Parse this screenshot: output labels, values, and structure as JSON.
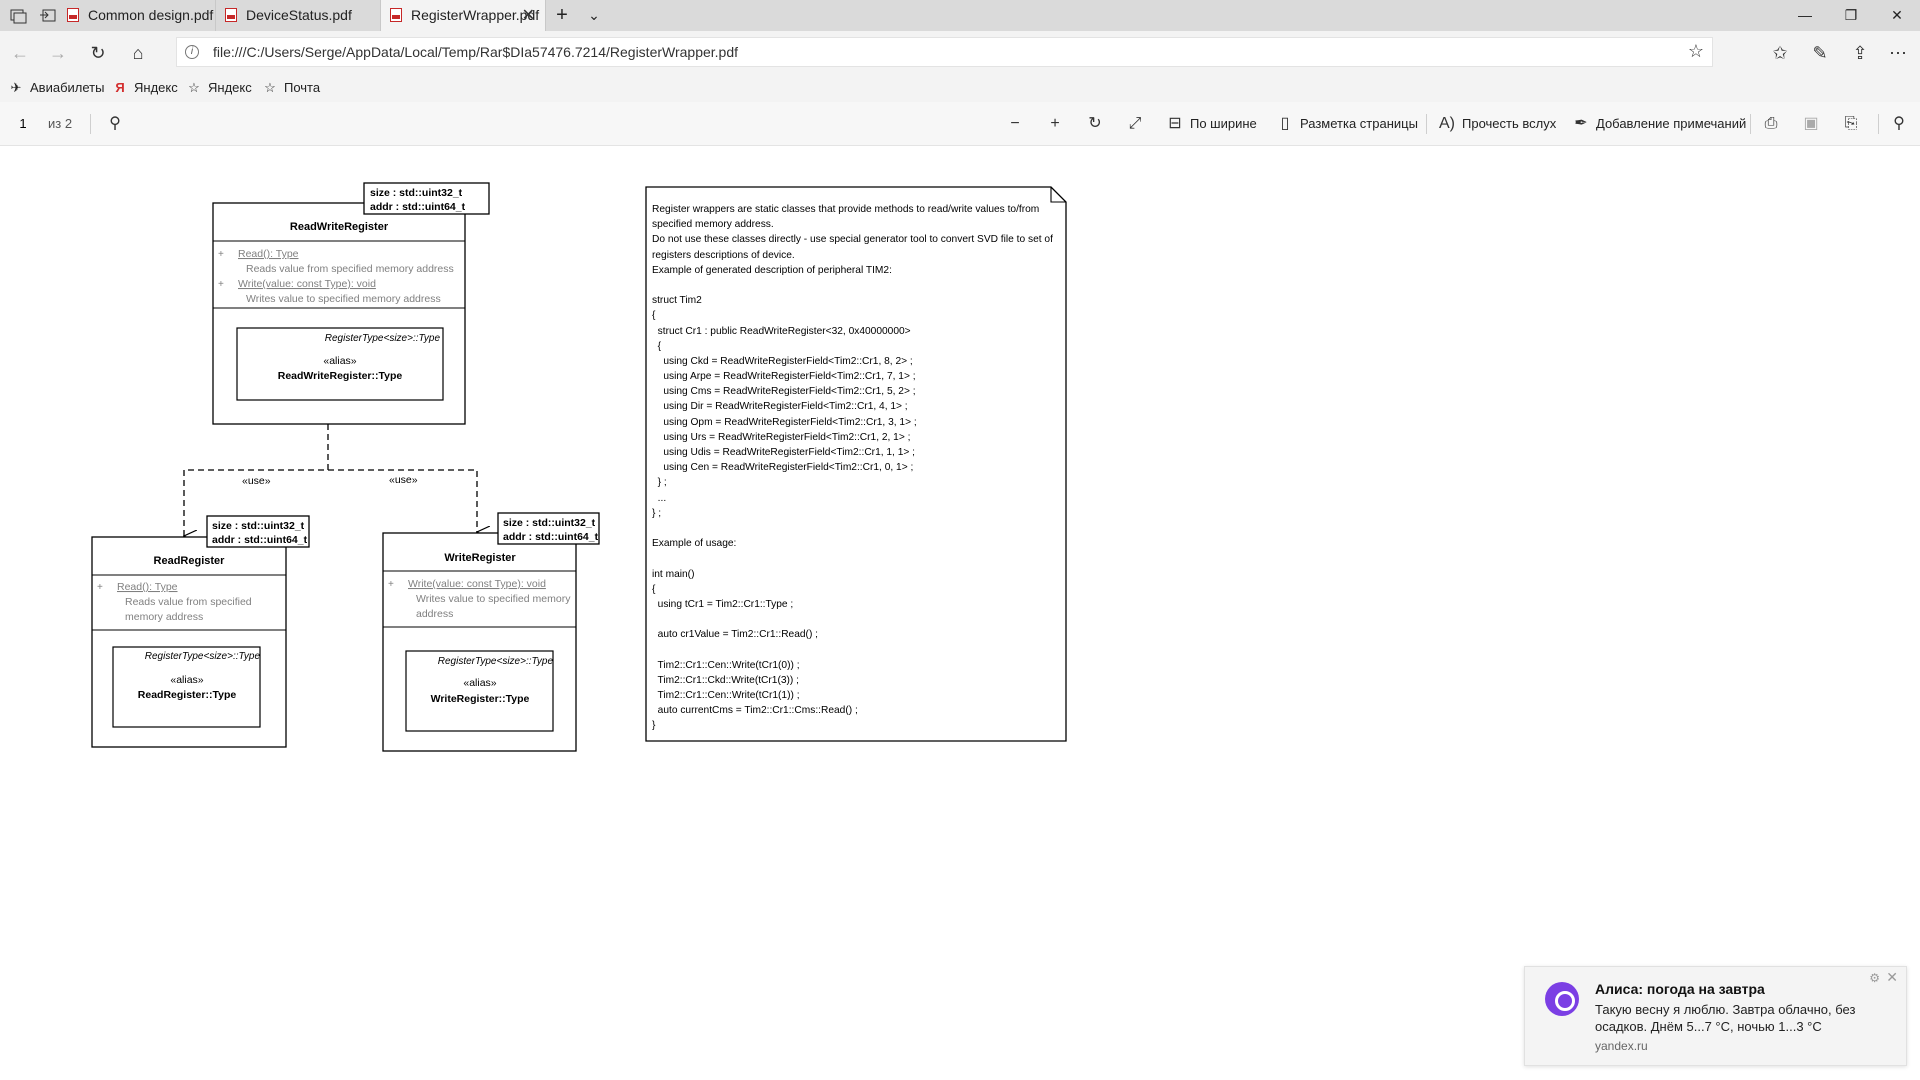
{
  "tabs": [
    {
      "label": "Common design.pdf",
      "active": false
    },
    {
      "label": "DeviceStatus.pdf",
      "active": false
    },
    {
      "label": "RegisterWrapper.pdf",
      "active": true
    }
  ],
  "window": {
    "minimize": "—",
    "restore": "❐",
    "close": "✕"
  },
  "address": {
    "url": "file:///C:/Users/Serge/AppData/Local/Temp/Rar$DIa57476.7214/RegisterWrapper.pdf"
  },
  "favorites": [
    {
      "label": "Авиабилеты",
      "icon": "plane-icon"
    },
    {
      "label": "Яндекс",
      "icon": "yandex-icon"
    },
    {
      "label": "Яндекс",
      "icon": "star-icon"
    },
    {
      "label": "Почта",
      "icon": "star-icon"
    }
  ],
  "pdf_toolbar": {
    "page": "1",
    "page_total": "из 2",
    "fit_width": "По ширине",
    "page_layout": "Разметка страницы",
    "read_aloud": "Прочесть вслух",
    "add_notes": "Добавление примечаний"
  },
  "diagram": {
    "rwr": {
      "template_size": "size : std::uint32_t",
      "template_addr": "addr : std::uint64_t",
      "name": "ReadWriteRegister",
      "op1": "Read(): Type",
      "op1_desc": "Reads value from specified memory address",
      "op2": "Write(value: const Type): void",
      "op2_desc": "Writes value to specified memory address",
      "inner_type": "RegisterType<size>::Type",
      "inner_stereo": "«alias»",
      "inner_name": "ReadWriteRegister::Type"
    },
    "use_left": "«use»",
    "use_right": "«use»",
    "rr": {
      "template_size": "size : std::uint32_t",
      "template_addr": "addr : std::uint64_t",
      "name": "ReadRegister",
      "op1": "Read(): Type",
      "op1_desc_1": "Reads value from specified",
      "op1_desc_2": "memory address",
      "inner_type": "RegisterType<size>::Type",
      "inner_stereo": "«alias»",
      "inner_name": "ReadRegister::Type"
    },
    "wr": {
      "template_size": "size : std::uint32_t",
      "template_addr": "addr : std::uint64_t",
      "name": "WriteRegister",
      "op1": "Write(value: const Type): void",
      "op1_desc_1": "Writes value to specified memory",
      "op1_desc_2": "address",
      "inner_type": "RegisterType<size>::Type",
      "inner_stereo": "«alias»",
      "inner_name": "WriteRegister::Type"
    }
  },
  "note_lines": [
    "Register wrappers are static classes that provide methods to read/write values to/from",
    "specified memory address.",
    "Do not use these classes directly - use special generator tool to convert SVD file to set of",
    "registers descriptions of device.",
    "Example of generated description of peripheral TIM2:",
    "",
    "struct Tim2",
    "{",
    "  struct Cr1 : public ReadWriteRegister<32, 0x40000000>",
    "  {",
    "    using Ckd = ReadWriteRegisterField<Tim2::Cr1, 8, 2> ;",
    "    using Arpe = ReadWriteRegisterField<Tim2::Cr1, 7, 1> ;",
    "    using Cms = ReadWriteRegisterField<Tim2::Cr1, 5, 2> ;",
    "    using Dir = ReadWriteRegisterField<Tim2::Cr1, 4, 1> ;",
    "    using Opm = ReadWriteRegisterField<Tim2::Cr1, 3, 1> ;",
    "    using Urs = ReadWriteRegisterField<Tim2::Cr1, 2, 1> ;",
    "    using Udis = ReadWriteRegisterField<Tim2::Cr1, 1, 1> ;",
    "    using Cen = ReadWriteRegisterField<Tim2::Cr1, 0, 1> ;",
    "  } ;",
    "  ...",
    "} ;",
    "",
    "Example of usage:",
    "",
    "int main()",
    "{",
    "  using tCr1 = Tim2::Cr1::Type ;",
    "",
    "  auto cr1Value = Tim2::Cr1::Read() ;",
    "",
    "  Tim2::Cr1::Cen::Write(tCr1(0)) ;",
    "  Tim2::Cr1::Ckd::Write(tCr1(3)) ;",
    "  Tim2::Cr1::Cen::Write(tCr1(1)) ;",
    "  auto currentCms = Tim2::Cr1::Cms::Read() ;",
    "}"
  ],
  "notification": {
    "title": "Алиса: погода на завтра",
    "body": "Такую весну я люблю. Завтра облачно, без осадков. Днём 5...7 °C, ночью 1...3 °C",
    "source": "yandex.ru"
  },
  "colors": {
    "alice": "#7b3fe4",
    "pdf_icon": "#c62828",
    "operation_gray": "#808080"
  }
}
